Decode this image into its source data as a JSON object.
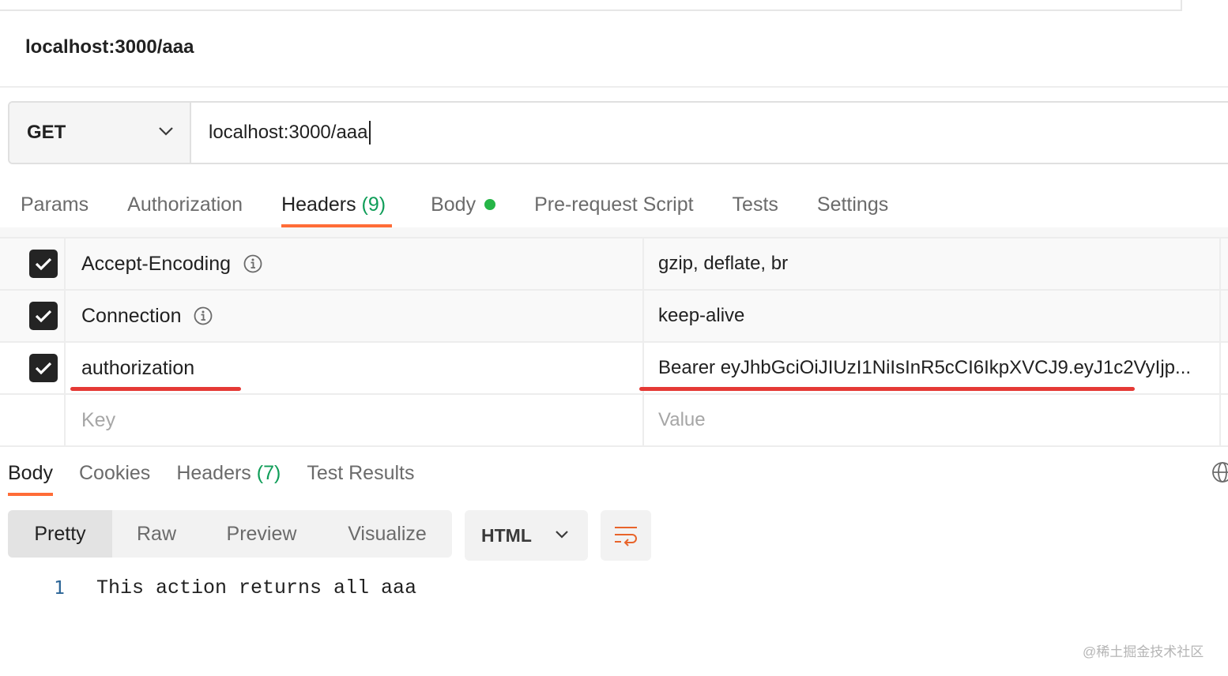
{
  "request": {
    "title": "localhost:3000/aaa",
    "method": "GET",
    "url": "localhost:3000/aaa"
  },
  "request_tabs": [
    {
      "label": "Params"
    },
    {
      "label": "Authorization"
    },
    {
      "label": "Headers",
      "count": "(9)",
      "active": true
    },
    {
      "label": "Body",
      "has_dot": true
    },
    {
      "label": "Pre-request Script"
    },
    {
      "label": "Tests"
    },
    {
      "label": "Settings"
    }
  ],
  "headers": [
    {
      "key": "Accept-Encoding",
      "value": "gzip, deflate, br",
      "checked": true,
      "has_info": true
    },
    {
      "key": "Connection",
      "value": "keep-alive",
      "checked": true,
      "has_info": true
    },
    {
      "key": "authorization",
      "value": "Bearer eyJhbGciOiJIUzI1NiIsInR5cCI6IkpXVCJ9.eyJ1c2VyIjp...",
      "checked": true,
      "has_info": false
    }
  ],
  "new_header": {
    "key_placeholder": "Key",
    "value_placeholder": "Value"
  },
  "response_tabs": [
    {
      "label": "Body",
      "active": true
    },
    {
      "label": "Cookies"
    },
    {
      "label": "Headers",
      "count": "(7)"
    },
    {
      "label": "Test Results"
    }
  ],
  "view_modes": [
    "Pretty",
    "Raw",
    "Preview",
    "Visualize"
  ],
  "active_view_mode": "Pretty",
  "format": "HTML",
  "response_body": [
    {
      "line": "1",
      "text": "This action returns all aaa"
    }
  ],
  "watermark": "@稀土掘金技术社区",
  "colors": {
    "accent_orange": "#ff6c37",
    "count_green": "#0f9d58",
    "annotation_red": "#e53935",
    "body_dot_green": "#26b547"
  }
}
